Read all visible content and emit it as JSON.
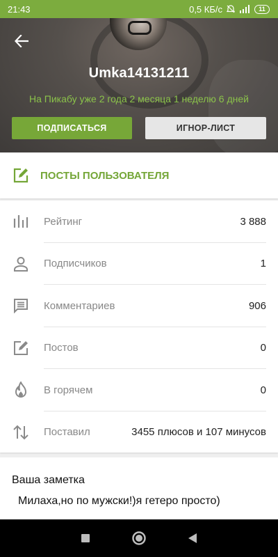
{
  "status_bar": {
    "time": "21:43",
    "network_speed": "0,5 КБ/с",
    "battery": "11"
  },
  "profile": {
    "username": "Umka14131211",
    "since": "На Пикабу уже 2 года 2 месяца 1 неделю 6 дней",
    "subscribe_label": "ПОДПИСАТЬСЯ",
    "ignore_label": "ИГНОР-ЛИСТ"
  },
  "posts_link": {
    "label": "ПОСТЫ ПОЛЬЗОВАТЕЛЯ"
  },
  "stats": [
    {
      "name": "Рейтинг",
      "value": "3 888",
      "icon": "rating-bars-icon"
    },
    {
      "name": "Подписчиков",
      "value": "1",
      "icon": "person-icon"
    },
    {
      "name": "Комментариев",
      "value": "906",
      "icon": "comment-icon"
    },
    {
      "name": "Постов",
      "value": "0",
      "icon": "edit-square-icon"
    },
    {
      "name": "В горячем",
      "value": "0",
      "icon": "flame-icon"
    },
    {
      "name": "Поставил",
      "value": "3455 плюсов и 107 минусов",
      "icon": "swap-vertical-icon"
    }
  ],
  "note": {
    "title": "Ваша заметка",
    "text": "Милаха,но по мужски!)я гетеро просто)"
  },
  "colors": {
    "accent": "#77a738",
    "status_bar": "#7cac3e",
    "text_secondary": "#888888"
  }
}
